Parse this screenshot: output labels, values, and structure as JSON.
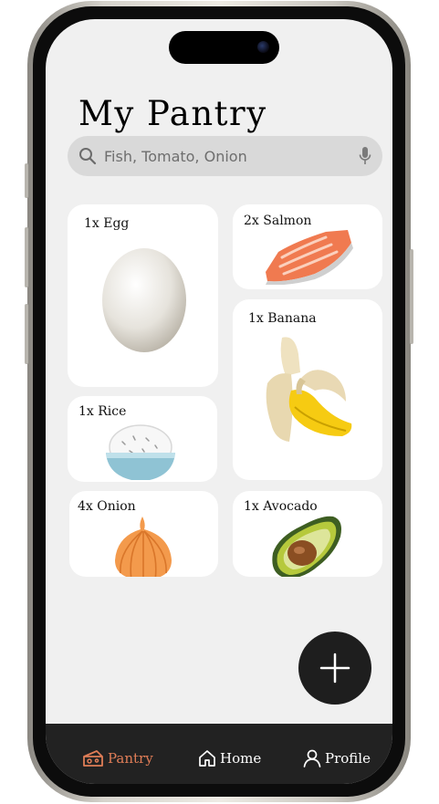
{
  "header": {
    "title": "My Pantry"
  },
  "search": {
    "placeholder": "Fish, Tomato, Onion"
  },
  "items": [
    {
      "label": "1x Egg",
      "icon": "egg-icon"
    },
    {
      "label": "2x Salmon",
      "icon": "salmon-icon"
    },
    {
      "label": "1x Banana",
      "icon": "banana-icon"
    },
    {
      "label": "1x Rice",
      "icon": "rice-bowl-icon"
    },
    {
      "label": "4x Onion",
      "icon": "onion-icon"
    },
    {
      "label": "1x Avocado",
      "icon": "avocado-icon"
    }
  ],
  "nav": {
    "pantry": "Pantry",
    "home": "Home",
    "profile": "Profile",
    "active": "pantry",
    "active_color": "#e07d57"
  },
  "colors": {
    "screen_bg": "#f0f0f0",
    "card_bg": "#ffffff",
    "nav_bg": "#222222",
    "fab_bg": "#1e1e1e"
  }
}
